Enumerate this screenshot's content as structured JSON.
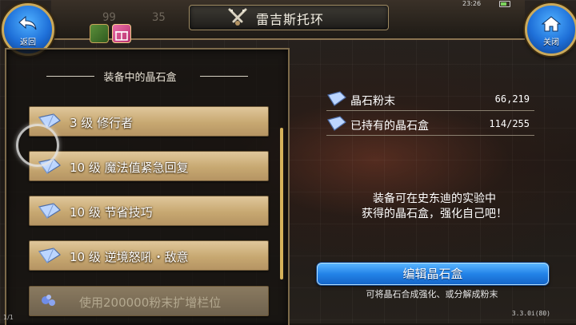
{
  "header": {
    "title": "雷吉斯托环",
    "back_label": "返回",
    "close_label": "关闭",
    "bg_numbers": [
      "99",
      "35"
    ],
    "clock": "23:26"
  },
  "left_panel": {
    "heading": "装备中的晶石盒",
    "items": [
      {
        "text": "3 级 修行者"
      },
      {
        "text": "10 级 魔法值紧急回复"
      },
      {
        "text": "10 级 节省技巧"
      },
      {
        "text": "10 级 逆境怒吼・敌意"
      },
      {
        "text": "使用200000粉末扩增栏位"
      }
    ],
    "page_indicator": "1/1"
  },
  "right_panel": {
    "stats": [
      {
        "name": "晶石粉末",
        "value": "66,219"
      },
      {
        "name": "已持有的晶石盒",
        "value": "114/255"
      }
    ],
    "description_line1": "装备可在史东迪的实验中",
    "description_line2": "获得的晶石盒，强化自己吧！",
    "edit_button": "编辑晶石盒",
    "hint": "可将晶石合成强化、或分解成粉末"
  },
  "version": "3.3.0i(80)",
  "colors": {
    "accent_blue": "#2383e8",
    "item_gold": "#c7a871",
    "frame_gold": "#caa95b"
  },
  "icons": [
    "back-icon",
    "home-icon",
    "gem-icon",
    "crossed-swords-icon",
    "gift-icon",
    "battery-icon"
  ]
}
